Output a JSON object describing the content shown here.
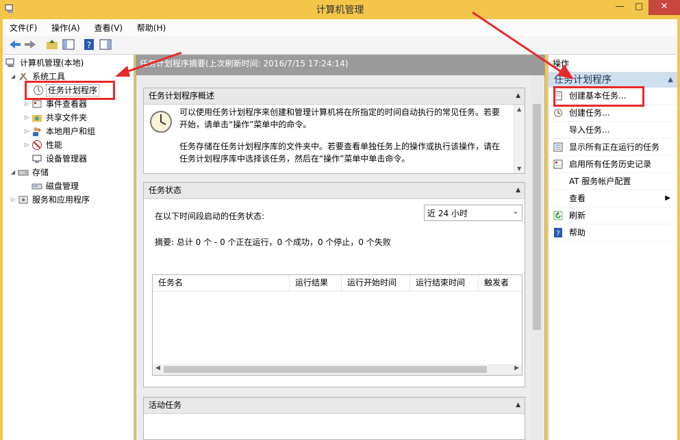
{
  "window": {
    "title": "计算机管理",
    "minimize": "—",
    "maximize": "□",
    "close": "✕"
  },
  "menu": [
    "文件(F)",
    "操作(A)",
    "查看(V)",
    "帮助(H)"
  ],
  "tree": {
    "root": "计算机管理(本地)",
    "system_tools": "系统工具",
    "task_scheduler": "任务计划程序",
    "event_viewer": "事件查看器",
    "shared_folders": "共享文件夹",
    "local_users": "本地用户和组",
    "performance": "性能",
    "device_manager": "设备管理器",
    "storage": "存储",
    "disk_management": "磁盘管理",
    "services_apps": "服务和应用程序"
  },
  "center": {
    "summary_title": "任务计划程序摘要(上次刷新时间: 2016/7/15 17:24:14)",
    "overview": {
      "header": "任务计划程序概述",
      "para1_line1": "可以使用任务计划程序来创建和管理计算机将在所指定的时间自动执行的常见任务。若要",
      "para1_line2": "开始，请单击“操作”菜单中的命令。",
      "para2_line1": "任务存储在任务计划程序库的文件夹中。若要查看单独任务上的操作或执行该操作，请在",
      "para2_line2": "任务计划程序库中选择该任务，然后在“操作”菜单中单击命令。"
    },
    "status": {
      "header": "任务状态",
      "period_label": "在以下时间段启动的任务状态:",
      "period_value": "近 24 小时",
      "summary": "摘要: 总计 0 个 - 0 个正在运行，0 个成功，0 个停止，0 个失败",
      "columns": [
        "任务名",
        "运行结果",
        "运行开始时间",
        "运行结束时间",
        "触发者"
      ]
    },
    "active": {
      "header": "活动任务"
    }
  },
  "actions": {
    "header": "操作",
    "section": "任务计划程序",
    "items": [
      "创建基本任务...",
      "创建任务...",
      "导入任务...",
      "显示所有正在运行的任务",
      "启用所有任务历史记录",
      "AT 服务帐户配置",
      "查看",
      "刷新",
      "帮助"
    ]
  },
  "colors": {
    "highlight": "#e8282a",
    "title_bar": "#f3c64a",
    "action_section": "#cfdfee"
  }
}
